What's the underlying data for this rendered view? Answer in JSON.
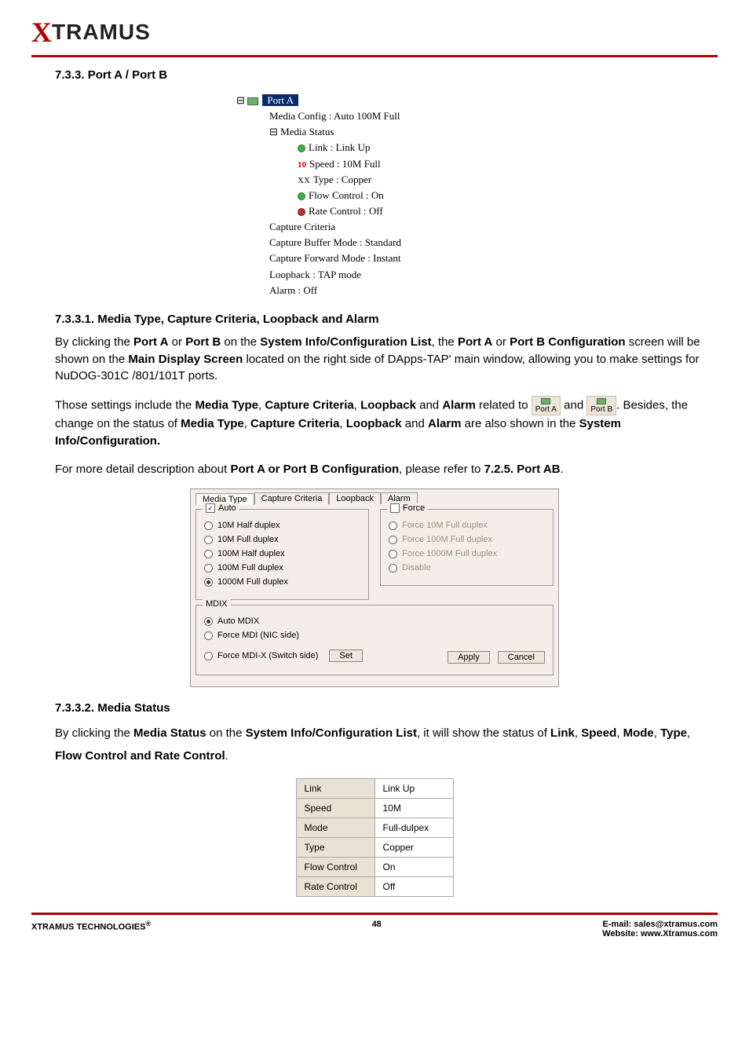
{
  "logo": {
    "x": "X",
    "text": "TRAMUS"
  },
  "section_title": "7.3.3. Port A / Port B",
  "tree": {
    "port_label": "Port A",
    "media_config": "Media Config : Auto 100M Full",
    "media_status": "Media Status",
    "link": "Link : Link Up",
    "speed_prefix": "10",
    "speed": "Speed : 10M Full",
    "type_prefix": "XX",
    "type": "Type : Copper",
    "flow": "Flow Control : On",
    "rate": "Rate Control : Off",
    "capture_criteria": "Capture Criteria",
    "capture_buffer": "Capture Buffer Mode : Standard",
    "capture_forward": "Capture Forward Mode : Instant",
    "loopback": "Loopback : TAP mode",
    "alarm": "Alarm : Off"
  },
  "h1": "7.3.3.1. Media Type, Capture Criteria, Loopback and Alarm",
  "p1_a": "By clicking the ",
  "p1_b": "Port A",
  "p1_c": " or ",
  "p1_d": "Port B",
  "p1_e": " on the ",
  "p1_f": "System Info/Configuration List",
  "p1_g": ", the ",
  "p1_h": "Port A",
  "p1_i": " or ",
  "p1_j": "Port B Configuration",
  "p1_k": " screen will be shown on the ",
  "p1_l": "Main Display Screen",
  "p1_m": " located on the right side of DApps-TAP' main window, allowing you to make settings for NuDOG-301C /801/101T ports.",
  "p2_a": "Those settings include the ",
  "p2_b": "Media Type",
  "p2_c": ", ",
  "p2_d": "Capture Criteria",
  "p2_e": ", ",
  "p2_f": "Loopback",
  "p2_g": " and ",
  "p2_h": "Alarm",
  "p2_i": " related to ",
  "p2_portA": "Port A",
  "p2_j": " and ",
  "p2_portB": "Port B",
  "p2_k": ". Besides, the change on the status of ",
  "p2_l": "Media Type",
  "p2_m": "Capture Criteria",
  "p2_n": "Loopback",
  "p2_o": "Alarm",
  "p2_p": " are also shown in the ",
  "p2_q": "System Info/Configuration.",
  "p3_a": "For more detail description about ",
  "p3_b": "Port A or Port B Configuration",
  "p3_c": ", please refer to ",
  "p3_d": "7.2.5. Port AB",
  "p3_e": ".",
  "panel": {
    "tabs": [
      "Media Type",
      "Capture Criteria",
      "Loopback",
      "Alarm"
    ],
    "auto_legend": "Auto",
    "force_legend": "Force",
    "auto_opts": [
      "10M Half duplex",
      "10M Full duplex",
      "100M Half duplex",
      "100M Full duplex",
      "1000M Full duplex"
    ],
    "force_opts": [
      "Force 10M Full duplex",
      "Force 100M Full duplex",
      "Force 1000M Full duplex",
      "Disable"
    ],
    "mdix_legend": "MDIX",
    "mdix_opts": [
      "Auto MDIX",
      "Force MDI (NIC side)",
      "Force MDI-X (Switch side)"
    ],
    "set_btn": "Set",
    "apply_btn": "Apply",
    "cancel_btn": "Cancel"
  },
  "h2": "7.3.3.2. Media Status",
  "p4_a": "By clicking the ",
  "p4_b": "Media Status",
  "p4_c": " on the ",
  "p4_d": "System Info/Configuration List",
  "p4_e": ", it will show the status of ",
  "p4_f": "Link",
  "p4_g": ", ",
  "p4_h": "Speed",
  "p4_i": ", ",
  "p4_j": "Mode",
  "p4_k": ", ",
  "p4_l": "Type",
  "p4_m": ", ",
  "p4_n": "Flow Control and Rate Control",
  "p4_o": ".",
  "status_table": {
    "rows": [
      {
        "label": "Link",
        "value": "Link Up"
      },
      {
        "label": "Speed",
        "value": "10M"
      },
      {
        "label": "Mode",
        "value": "Full-dulpex"
      },
      {
        "label": "Type",
        "value": "Copper"
      },
      {
        "label": "Flow Control",
        "value": "On"
      },
      {
        "label": "Rate Control",
        "value": "Off"
      }
    ]
  },
  "footer": {
    "left": "XTRAMUS TECHNOLOGIES",
    "reg": "®",
    "page": "48",
    "email_label": "E-mail: ",
    "email": "sales@xtramus.com",
    "site_label": "Website:  ",
    "site": "www.Xtramus.com"
  }
}
